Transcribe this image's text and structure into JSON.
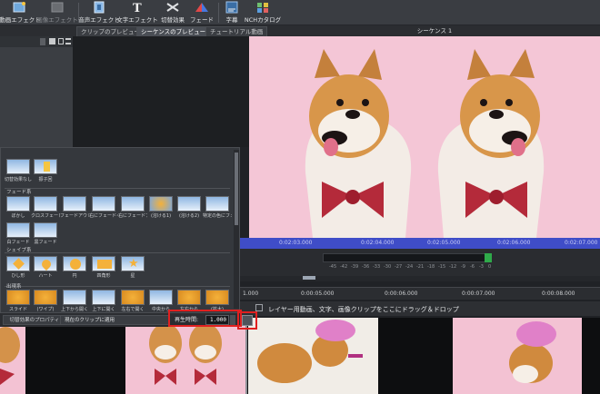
{
  "toolbar": {
    "buttons": [
      {
        "label": "動画エフェクト",
        "enabled": true
      },
      {
        "label": "画像エフェクト",
        "enabled": false
      },
      {
        "label": "音声エフェクト",
        "enabled": true
      },
      {
        "label": "文字エフェクト",
        "enabled": true
      },
      {
        "label": "切替効果",
        "enabled": true
      },
      {
        "label": "フェード",
        "enabled": true
      },
      {
        "label": "字幕",
        "enabled": true
      },
      {
        "label": "NCHカタログ",
        "enabled": true
      }
    ]
  },
  "tabs": [
    {
      "label": "クリップのプレビュー",
      "active": false
    },
    {
      "label": "シーケンスのプレビュー",
      "active": true
    },
    {
      "label": "チュートリアル動画",
      "active": false
    }
  ],
  "sequence_title": "シーケンス 1",
  "ruler": {
    "labels": [
      "0:02:03.000",
      "0:02:04.000",
      "0:02:05.000",
      "0:02:06.000",
      "0:02:07.000"
    ]
  },
  "meter": {
    "labels": [
      "-45",
      "-42",
      "-39",
      "-36",
      "-33",
      "-30",
      "-27",
      "-24",
      "-21",
      "-18",
      "-15",
      "-12",
      "-9",
      "-6",
      "-3",
      "0"
    ]
  },
  "timeline": {
    "labels": [
      "1.000",
      "0:00:05.000",
      "0:00:06.000",
      "0:00:07.000",
      "0:00:08.000"
    ],
    "overlay_hint": "レイヤー用動画、文字、画像クリップをここにドラッグ＆ドロップ"
  },
  "transitions": {
    "top_row": [
      "切替効果なし",
      "振子回"
    ],
    "sections": [
      {
        "title": "フェード系",
        "items": [
          "ぼかし",
          "クロスフェード",
          "フェードアウト",
          "右にフェードイン",
          "右にフェードアウト",
          "(溶ける1)",
          "(溶ける2)",
          "特定の色にフェード"
        ]
      },
      {
        "title": "",
        "items": [
          "白フェード",
          "黒フェード"
        ]
      },
      {
        "title": "シェイプ系",
        "items": [
          "ひし形",
          "ハート",
          "円",
          "四角形",
          "星"
        ]
      },
      {
        "title": "出現系",
        "items": [
          "スライド",
          "(ワイプ)",
          "上下から開く",
          "上下に開く",
          "左右で開く",
          "中央から",
          "左右から",
          "(拡大)"
        ]
      }
    ],
    "properties_button": "切替効果のプロパティ",
    "apply_select": "現在のクリップに適用",
    "duration_label": "再生時間:",
    "duration_value": "1.000"
  },
  "colors": {
    "accent_ruler": "#3f4dc8",
    "highlight": "#e02020",
    "preview_bg": "#f4c6d6"
  }
}
